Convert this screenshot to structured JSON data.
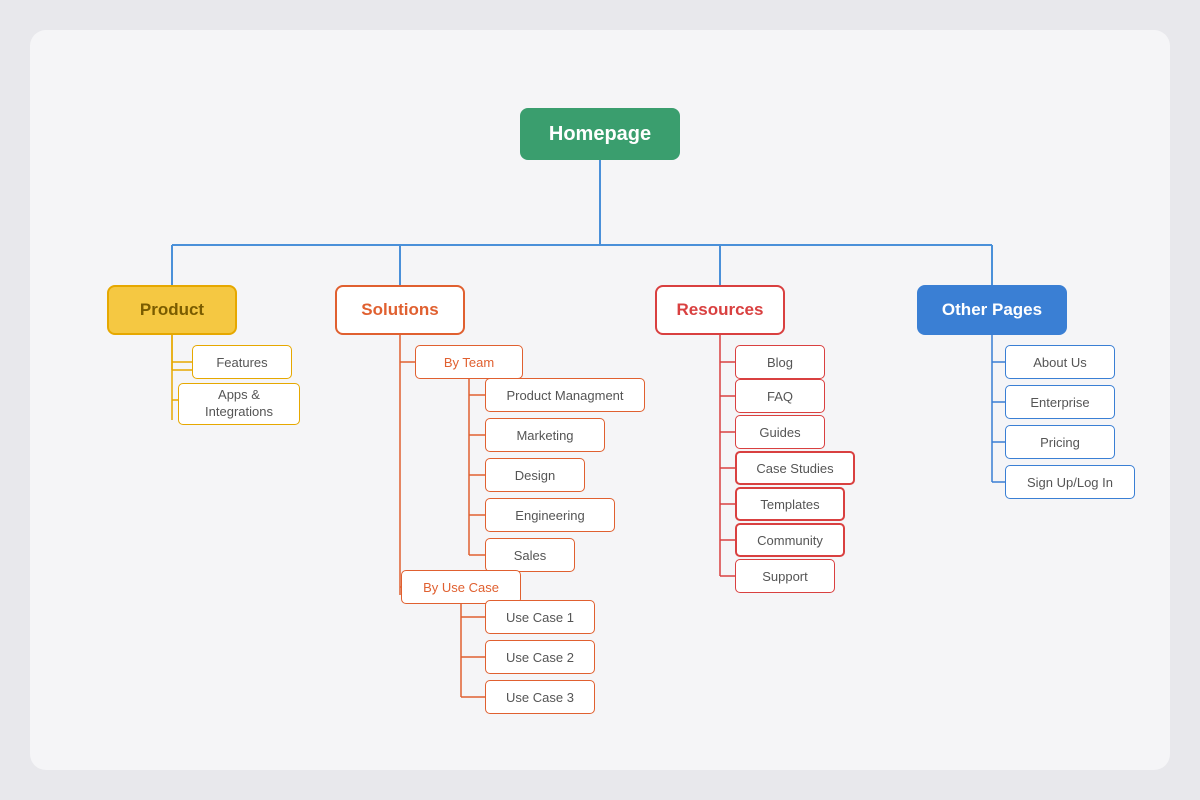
{
  "nodes": {
    "root": {
      "label": "Homepage"
    },
    "product": {
      "label": "Product"
    },
    "solutions": {
      "label": "Solutions"
    },
    "resources": {
      "label": "Resources"
    },
    "otherpages": {
      "label": "Other Pages"
    },
    "features": {
      "label": "Features"
    },
    "apps": {
      "label": "Apps & Integrations"
    },
    "byteam": {
      "label": "By Team"
    },
    "byusecase": {
      "label": "By Use Case"
    },
    "productmgmt": {
      "label": "Product Managment"
    },
    "marketing": {
      "label": "Marketing"
    },
    "design": {
      "label": "Design"
    },
    "engineering": {
      "label": "Engineering"
    },
    "sales": {
      "label": "Sales"
    },
    "usecase1": {
      "label": "Use Case 1"
    },
    "usecase2": {
      "label": "Use Case 2"
    },
    "usecase3": {
      "label": "Use Case 3"
    },
    "blog": {
      "label": "Blog"
    },
    "faq": {
      "label": "FAQ"
    },
    "guides": {
      "label": "Guides"
    },
    "casestudies": {
      "label": "Case Studies"
    },
    "templates": {
      "label": "Templates"
    },
    "community": {
      "label": "Community"
    },
    "support": {
      "label": "Support"
    },
    "aboutus": {
      "label": "About Us"
    },
    "enterprise": {
      "label": "Enterprise"
    },
    "pricing": {
      "label": "Pricing"
    },
    "signup": {
      "label": "Sign Up/Log In"
    }
  }
}
